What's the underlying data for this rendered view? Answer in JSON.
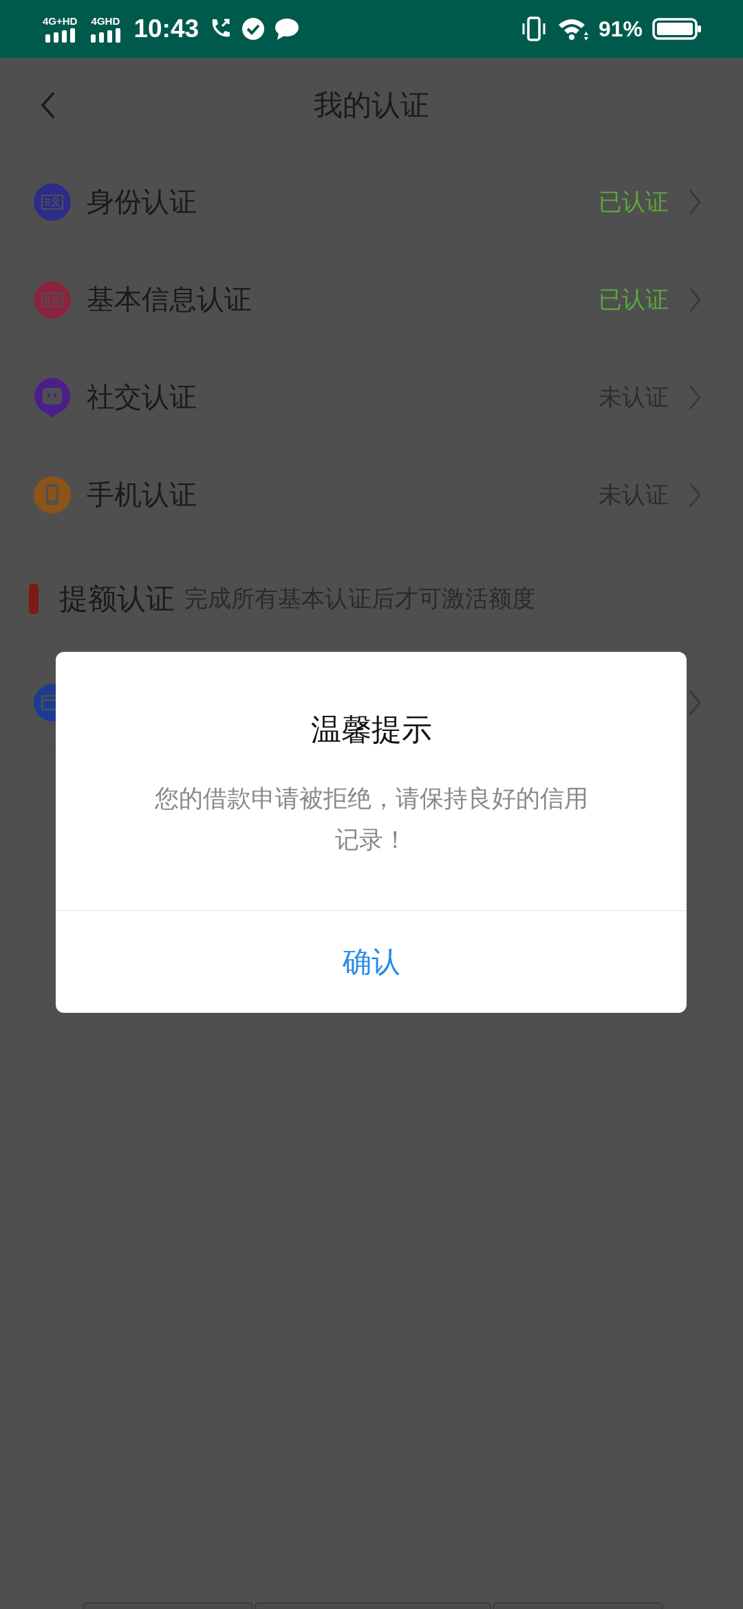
{
  "status_bar": {
    "networks": [
      "4G+HD",
      "4GHD"
    ],
    "time": "10:43",
    "battery": "91%"
  },
  "header": {
    "title": "我的认证"
  },
  "basic_items": [
    {
      "label": "身份认证",
      "status": "已认证",
      "verified": true,
      "color": "#2c2c8c",
      "kind": "id"
    },
    {
      "label": "基本信息认证",
      "status": "已认证",
      "verified": true,
      "color": "#8c2440",
      "kind": "id"
    },
    {
      "label": "社交认证",
      "status": "未认证",
      "verified": false,
      "color": "#4a1f8c",
      "kind": "chat"
    },
    {
      "label": "手机认证",
      "status": "未认证",
      "verified": false,
      "color": "#8c5418",
      "kind": "phone"
    }
  ],
  "section": {
    "title": "提额认证",
    "hint": "完成所有基本认证后才可激活额度"
  },
  "credit_items": [
    {
      "color": "#1c3c94",
      "kind": "card"
    }
  ],
  "dialog": {
    "title": "温馨提示",
    "message": "您的借款申请被拒绝，请保持良好的信用记录！",
    "button": "确认"
  }
}
